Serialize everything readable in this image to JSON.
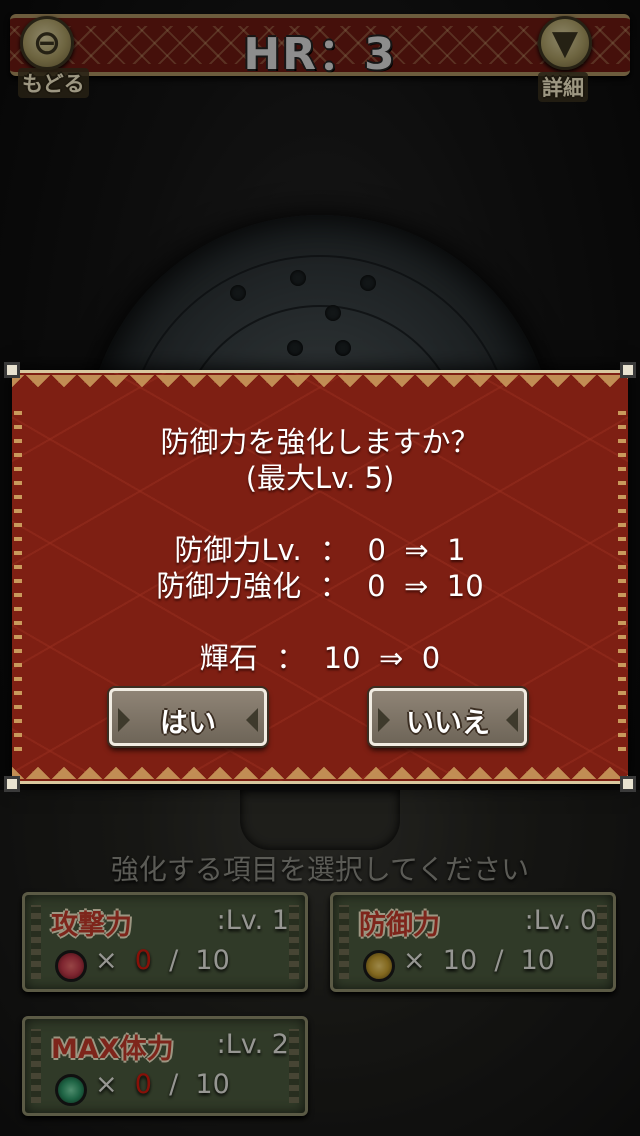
{
  "header": {
    "title": "HR：3",
    "back_label": "もどる",
    "detail_label": "詳細"
  },
  "dialog": {
    "question": "防御力を強化しますか？",
    "max_level": "(最大Lv. 5)",
    "level_change": "防御力Lv.  ：  0  ⇒  1",
    "enhance_change": "防御力強化  ：  0  ⇒  10",
    "stone_change": "輝石  ：  10  ⇒  0",
    "yes_label": "はい",
    "no_label": "いいえ"
  },
  "select_hint": "強化する項目を選択してください",
  "skills": [
    {
      "name": "攻撃力",
      "level": ":Lv.  1",
      "prefix": "×  ",
      "current": "0",
      "suffix": "  /  10",
      "gem_color": "#c23a4a"
    },
    {
      "name": "防御力",
      "level": ":Lv.  0",
      "prefix": "×  ",
      "current": "10",
      "suffix": "  /  10",
      "gem_color": "#c8a030"
    },
    {
      "name": "MAX体力",
      "level": ":Lv.  2",
      "prefix": "×  ",
      "current": "0",
      "suffix": "  /  10",
      "gem_color": "#2f9a6a"
    }
  ],
  "colors": {
    "modal_red": "#7e1f13",
    "card_green": "#4b5a3e",
    "zero_red": "#d11a0d"
  }
}
